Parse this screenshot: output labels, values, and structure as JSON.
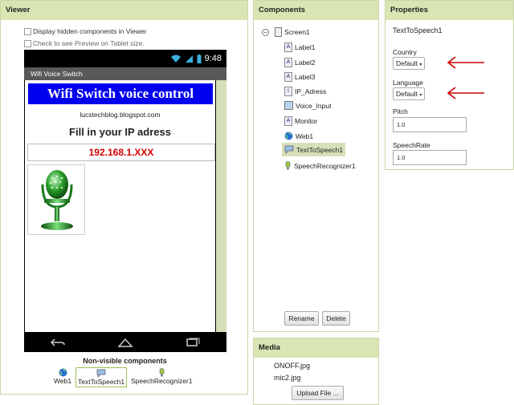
{
  "viewer": {
    "title": "Viewer",
    "show_hidden": "Display hidden components in Viewer",
    "tablet_preview": "Check to see Preview on Tablet size.",
    "phone": {
      "clock": "9:48",
      "app_title": "Wifi Voice Switch",
      "banner": "Wifi Switch voice control",
      "blog": "lucstechblog.blogspot.com",
      "prompt": "Fill in your IP adress",
      "ip_value": "192.168.1.XXX"
    },
    "nonvisible_title": "Non-visible components",
    "nonvisible": [
      "Web1",
      "TextToSpeech1",
      "SpeechRecognizer1"
    ]
  },
  "components": {
    "title": "Components",
    "tree": [
      "Screen1",
      "Label1",
      "Label2",
      "Label3",
      "IP_Adress",
      "Voice_Input",
      "Monitor",
      "Web1",
      "TextToSpeech1",
      "SpeechRecognizer1"
    ],
    "rename_label": "Rename",
    "delete_label": "Delete"
  },
  "media": {
    "title": "Media",
    "files": [
      "ONOFF.jpg",
      "mic2.jpg"
    ],
    "upload_label": "Upload File ..."
  },
  "properties": {
    "title": "Properties",
    "component": "TextToSpeech1",
    "country_label": "Country",
    "country_value": "Default",
    "language_label": "Language",
    "language_value": "Default",
    "pitch_label": "Pitch",
    "pitch_value": "1.0",
    "speechrate_label": "SpeechRate",
    "speechrate_value": "1.0"
  },
  "colors": {
    "panel_header": "#d9e5b3",
    "banner_blue": "#0000ee",
    "ip_red": "#d00000",
    "annotation_arrow": "#cc0000",
    "selected_item": "#d6e0b8"
  }
}
